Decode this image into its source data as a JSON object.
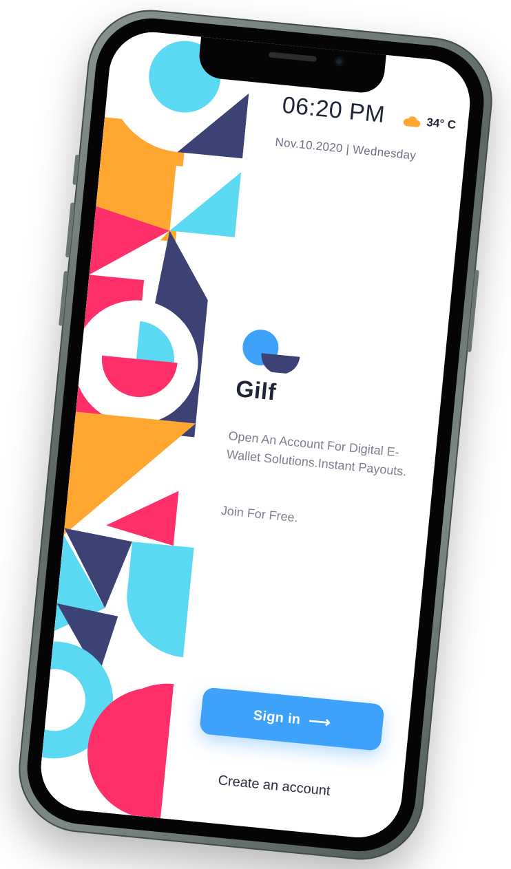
{
  "status": {
    "time": "06:20 PM",
    "temperature": "34° C",
    "weather_icon": "cloud-icon",
    "date": "Nov.10.2020 | Wednesday"
  },
  "app": {
    "name": "Gilf",
    "description": "Open An Account For Digital E-Wallet Solutions.Instant Payouts.",
    "join_text": "Join For Free."
  },
  "actions": {
    "sign_in": "Sign in",
    "sign_in_arrow": "⟶",
    "create_account": "Create an account"
  },
  "colors": {
    "accent_blue": "#3fa2fa",
    "navy": "#3c4274",
    "pink": "#ff3069",
    "orange": "#ffa731",
    "cyan": "#5bd9f2"
  }
}
